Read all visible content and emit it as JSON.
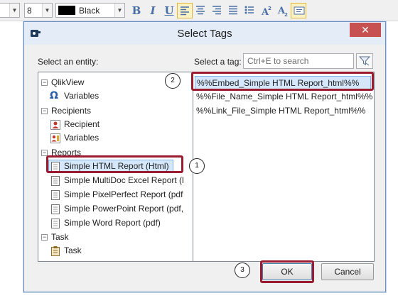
{
  "toolbar": {
    "font_size": "8",
    "color_name": "Black",
    "color_swatch": "#000000",
    "bold_glyph": "B",
    "italic_glyph": "I",
    "underline_glyph": "U"
  },
  "dialog": {
    "title": "Select Tags",
    "close_glyph": "✕",
    "entity_label": "Select an entity:",
    "tag_label": "Select a tag:",
    "search_placeholder": "Ctrl+E to search"
  },
  "tree": {
    "qlikview": {
      "label": "QlikView",
      "children": [
        "Variables"
      ]
    },
    "recipients": {
      "label": "Recipients",
      "children": [
        "Recipient",
        "Variables"
      ]
    },
    "reports": {
      "label": "Reports",
      "children": [
        "Simple HTML Report (Html)",
        "Simple MultiDoc Excel Report (l",
        "Simple PixelPerfect Report (pdf",
        "Simple PowerPoint Report (pdf,",
        "Simple Word Report (pdf)"
      ]
    },
    "task": {
      "label": "Task",
      "children": [
        "Task"
      ]
    },
    "collapse_glyph": "−"
  },
  "tags": [
    "%%Embed_Simple HTML Report_html%%",
    "%%File_Name_Simple HTML Report_html%%",
    "%%Link_File_Simple HTML Report_html%%"
  ],
  "buttons": {
    "ok": "OK",
    "cancel": "Cancel"
  },
  "callouts": [
    "1",
    "2",
    "3"
  ],
  "colors": {
    "highlight": "#9b1b30",
    "selection": "#d5e8fb",
    "close": "#c75050",
    "accent": "#4a6fa5"
  }
}
